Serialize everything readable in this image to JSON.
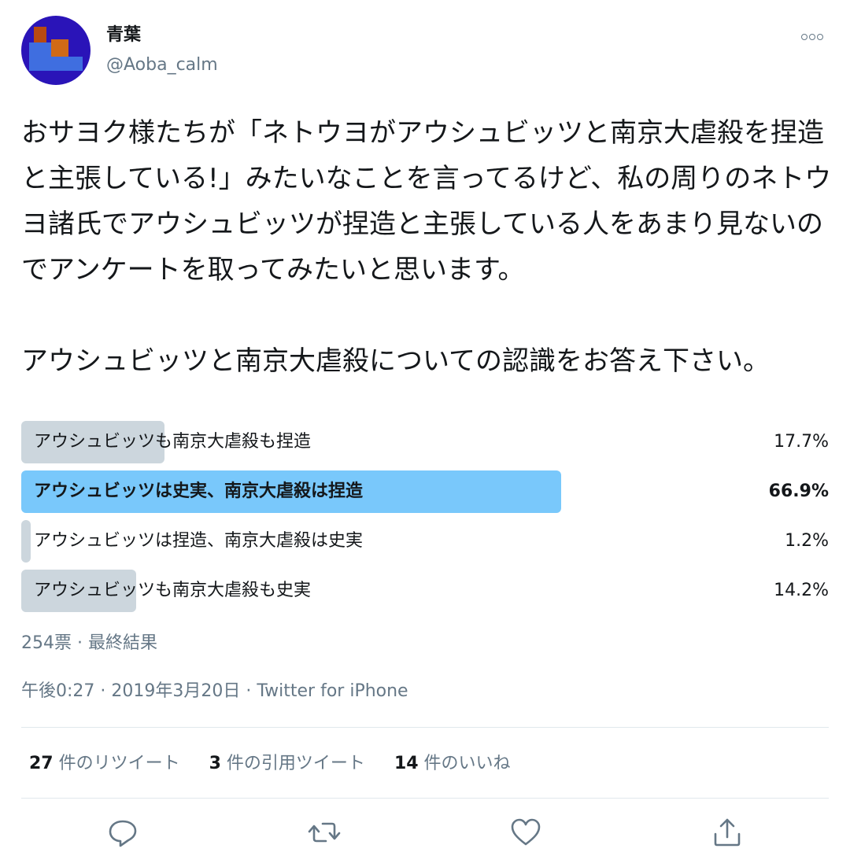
{
  "author": {
    "display_name": "青葉",
    "handle": "@Aoba_calm"
  },
  "tweet": {
    "text": "おサヨク様たちが「ネトウヨがアウシュビッツと南京大虐殺を捏造と主張している!」みたいなことを言ってるけど、私の周りのネトウヨ諸氏でアウシュビッツが捏造と主張している人をあまり見ないのでアンケートを取ってみたいと思います。\n\nアウシュビッツと南京大虐殺についての認識をお答え下さい。"
  },
  "poll": {
    "options": [
      {
        "label": "アウシュビッツも南京大虐殺も捏造",
        "percent_text": "17.7%",
        "percent": 17.7,
        "winner": false
      },
      {
        "label": "アウシュビッツは史実、南京大虐殺は捏造",
        "percent_text": "66.9%",
        "percent": 66.9,
        "winner": true
      },
      {
        "label": "アウシュビッツは捏造、南京大虐殺は史実",
        "percent_text": "1.2%",
        "percent": 1.2,
        "winner": false
      },
      {
        "label": "アウシュビッツも南京大虐殺も史実",
        "percent_text": "14.2%",
        "percent": 14.2,
        "winner": false
      }
    ],
    "summary": "254票 · 最終結果"
  },
  "meta": {
    "time_date": "午後0:27 · 2019年3月20日",
    "separator": " · ",
    "source": "Twitter for iPhone"
  },
  "stats": {
    "retweets_count": "27",
    "retweets_label": " 件のリツイート",
    "quotes_count": "3",
    "quotes_label": " 件の引用ツイート",
    "likes_count": "14",
    "likes_label": " 件のいいね"
  },
  "icons": {
    "reply": "reply-icon",
    "retweet": "retweet-icon",
    "like": "like-icon",
    "share": "share-icon",
    "more": "more-icon"
  },
  "colors": {
    "winner_bar": "#79c8fb",
    "bar": "#ccd6dd",
    "secondary_text": "#657786",
    "avatar_bg": "#2a14b8"
  }
}
